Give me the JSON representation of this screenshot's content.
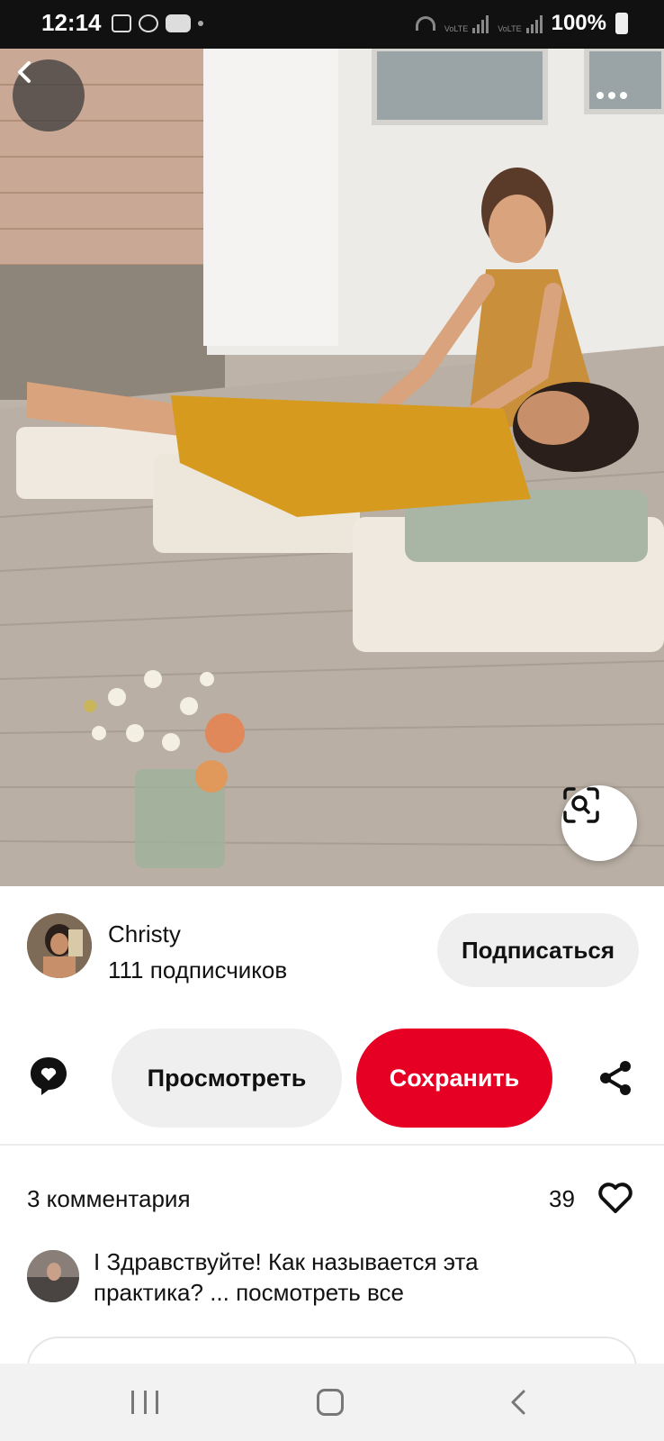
{
  "status_bar": {
    "time": "12:14",
    "left_icons": [
      "gallery-icon",
      "whatsapp-icon",
      "youtube-icon",
      "dot-icon"
    ],
    "network_labels": [
      "VoLTE",
      "VoLTE"
    ],
    "battery_text": "100%"
  },
  "pin": {
    "image_description_icons": [
      "back-icon",
      "more-icon",
      "visual-search-icon"
    ]
  },
  "author": {
    "name": "Christy",
    "followers": "111 подписчиков",
    "follow_label": "Подписаться"
  },
  "actions": {
    "view_label": "Просмотреть",
    "save_label": "Сохранить",
    "save_color": "#e60023"
  },
  "comments": {
    "count_label": "3 комментария",
    "likes": "39",
    "preview_text": "I Здравствуйте! Как называется эта практика? ... посмотреть все"
  }
}
